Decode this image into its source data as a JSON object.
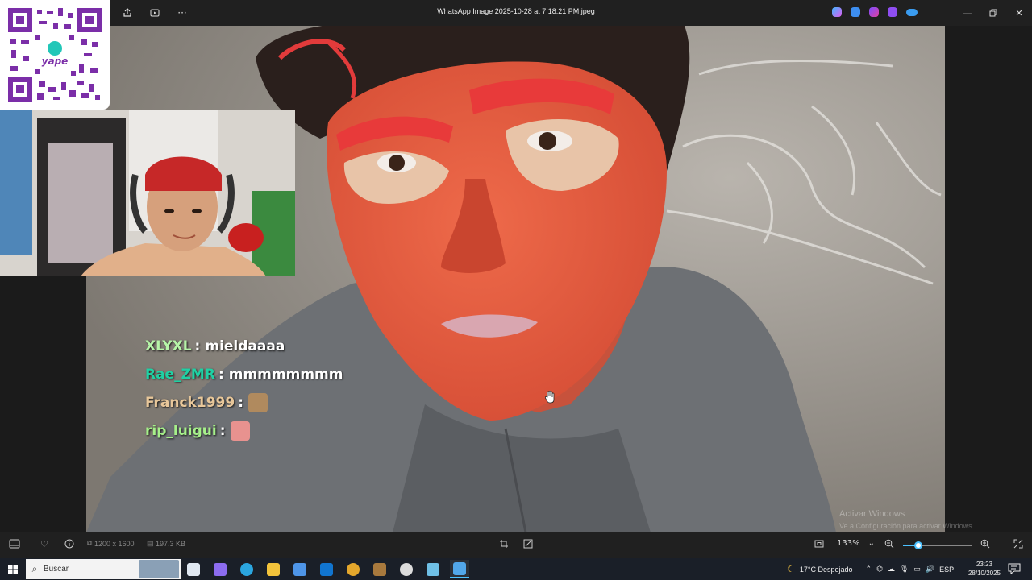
{
  "window": {
    "title": "WhatsApp Image 2025-10-28 at 7.18.21 PM.jpeg",
    "toolbar_icons": [
      "share-icon",
      "slideshow-icon",
      "more-icon"
    ],
    "app_icons": [
      "copilot-icon",
      "image-edit-icon",
      "clipchamp-icon",
      "designer-icon",
      "onedrive-icon"
    ],
    "controls": [
      "minimize-icon",
      "maximize-icon",
      "close-icon"
    ]
  },
  "overlay": {
    "qr_brand": "yape",
    "chat": [
      {
        "user": "XLYXL",
        "sep": ":",
        "msg": "mieldaaaa",
        "color": "#b6f5a8"
      },
      {
        "user": "Rae_ZMR",
        "sep": ":",
        "msg": "mmmmmmmm",
        "color": "#1fd1a4"
      },
      {
        "user": "Franck1999",
        "sep": ":",
        "msg": "",
        "emote": "dog-emote",
        "color": "#e8c79a"
      },
      {
        "user": "rip_luigui",
        "sep": ":",
        "msg": "",
        "emote": "pig-emote",
        "color": "#a6f08a"
      }
    ],
    "watermark_title": "Activar Windows",
    "watermark_sub": "Ve a Configuración para activar Windows."
  },
  "bottombar": {
    "dimensions": "1200 x 1600",
    "filesize": "197.3 KB",
    "zoom": "133%",
    "zoom_fraction": 0.22
  },
  "taskbar": {
    "search_placeholder": "Buscar",
    "weather": "17°C  Despejado",
    "language": "ESP",
    "time": "23:23",
    "date": "28/10/2025",
    "pinned": [
      {
        "name": "task-view-icon",
        "color": "#dfe7f1"
      },
      {
        "name": "copilot-icon",
        "color": "#8c6cf0"
      },
      {
        "name": "edge-icon",
        "color": "#2ba6e0"
      },
      {
        "name": "file-explorer-icon",
        "color": "#f3c33b"
      },
      {
        "name": "store-icon",
        "color": "#4e95e8"
      },
      {
        "name": "outlook-icon",
        "color": "#1175d0"
      },
      {
        "name": "chrome-icon",
        "color": "#e4a72c"
      },
      {
        "name": "box-icon",
        "color": "#a8793d"
      },
      {
        "name": "obs-icon",
        "color": "#dcdcdc"
      },
      {
        "name": "notepad-icon",
        "color": "#6fc0e6"
      },
      {
        "name": "photos-icon",
        "color": "#52a7ea"
      }
    ]
  }
}
